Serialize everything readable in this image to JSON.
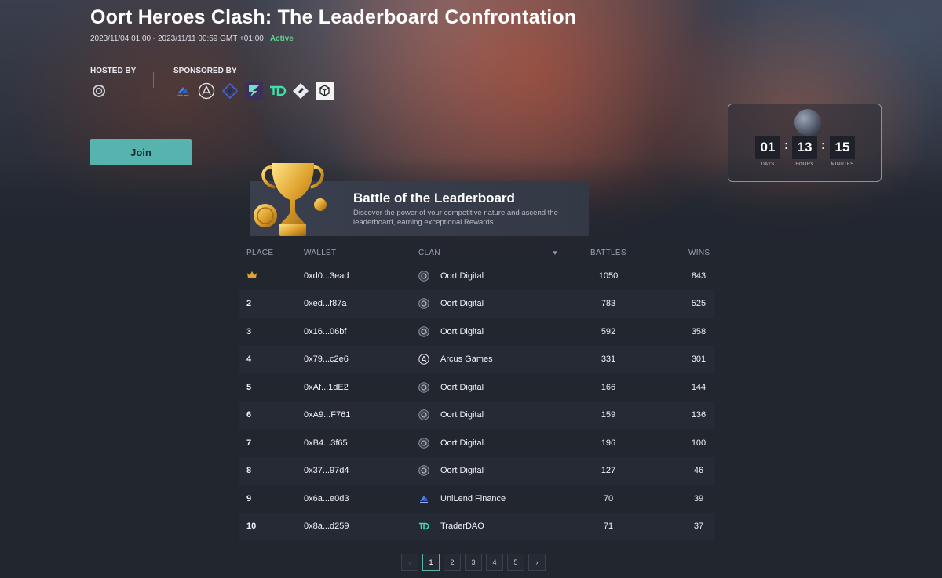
{
  "event": {
    "title": "Oort Heroes Clash: The Leaderboard Confrontation",
    "dates": "2023/11/04 01:00 - 2023/11/11 00:59 GMT +01:00",
    "status": "Active"
  },
  "hosted_by": {
    "label": "HOSTED BY"
  },
  "sponsored_by": {
    "label": "SPONSORED BY",
    "sponsors": [
      {
        "icon": "unilend-logo",
        "text": "UniLend"
      },
      {
        "icon": "arcus-logo"
      },
      {
        "icon": "diamond-logo"
      },
      {
        "icon": "lightning-logo"
      },
      {
        "icon": "traderdao-logo"
      },
      {
        "icon": "tag-logo"
      },
      {
        "icon": "box-logo"
      }
    ]
  },
  "join_label": "Join",
  "countdown": {
    "days": "01",
    "hours": "13",
    "minutes": "15",
    "days_label": "DAYS",
    "hours_label": "HOURS",
    "minutes_label": "MINUTES"
  },
  "banner": {
    "title": "Battle of the Leaderboard",
    "description": "Discover the power of your competitive nature and ascend the leaderboard, earning exceptional Rewards."
  },
  "table": {
    "headers": {
      "place": "PLACE",
      "wallet": "WALLET",
      "clan": "CLAN",
      "battles": "BATTLES",
      "wins": "WINS"
    },
    "rows": [
      {
        "place": "",
        "wallet": "0xd0...3ead",
        "clan": "Oort Digital",
        "clan_icon": "oort-icon",
        "battles": "1050",
        "wins": "843"
      },
      {
        "place": "2",
        "wallet": "0xed...f87a",
        "clan": "Oort Digital",
        "clan_icon": "oort-icon",
        "battles": "783",
        "wins": "525"
      },
      {
        "place": "3",
        "wallet": "0x16...06bf",
        "clan": "Oort Digital",
        "clan_icon": "oort-icon",
        "battles": "592",
        "wins": "358"
      },
      {
        "place": "4",
        "wallet": "0x79...c2e6",
        "clan": "Arcus Games",
        "clan_icon": "arcus-icon",
        "battles": "331",
        "wins": "301"
      },
      {
        "place": "5",
        "wallet": "0xAf...1dE2",
        "clan": "Oort Digital",
        "clan_icon": "oort-icon",
        "battles": "166",
        "wins": "144"
      },
      {
        "place": "6",
        "wallet": "0xA9...F761",
        "clan": "Oort Digital",
        "clan_icon": "oort-icon",
        "battles": "159",
        "wins": "136"
      },
      {
        "place": "7",
        "wallet": "0xB4...3f65",
        "clan": "Oort Digital",
        "clan_icon": "oort-icon",
        "battles": "196",
        "wins": "100"
      },
      {
        "place": "8",
        "wallet": "0x37...97d4",
        "clan": "Oort Digital",
        "clan_icon": "oort-icon",
        "battles": "127",
        "wins": "46"
      },
      {
        "place": "9",
        "wallet": "0x6a...e0d3",
        "clan": "UniLend Finance",
        "clan_icon": "unilend-icon",
        "battles": "70",
        "wins": "39"
      },
      {
        "place": "10",
        "wallet": "0x8a...d259",
        "clan": "TraderDAO",
        "clan_icon": "traderdao-icon",
        "battles": "71",
        "wins": "37"
      }
    ]
  },
  "pagination": {
    "pages": [
      "1",
      "2",
      "3",
      "4",
      "5"
    ],
    "current": "1",
    "prev": "‹",
    "next": "›"
  }
}
